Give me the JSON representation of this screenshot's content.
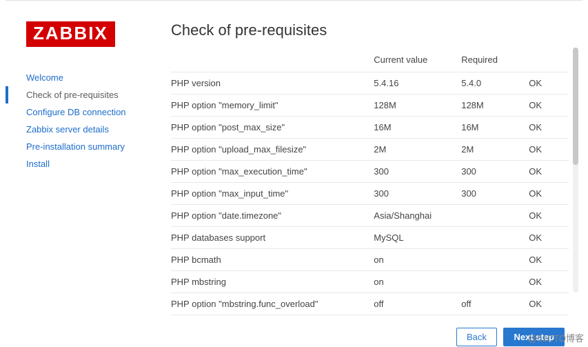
{
  "logo_text": "ZABBIX",
  "title": "Check of pre-requisites",
  "nav": {
    "items": [
      {
        "label": "Welcome",
        "active": false
      },
      {
        "label": "Check of pre-requisites",
        "active": true
      },
      {
        "label": "Configure DB connection",
        "active": false
      },
      {
        "label": "Zabbix server details",
        "active": false
      },
      {
        "label": "Pre-installation summary",
        "active": false
      },
      {
        "label": "Install",
        "active": false
      }
    ]
  },
  "table": {
    "headers": {
      "current": "Current value",
      "required": "Required"
    },
    "rows": [
      {
        "name": "PHP version",
        "current": "5.4.16",
        "required": "5.4.0",
        "status": "OK"
      },
      {
        "name": "PHP option \"memory_limit\"",
        "current": "128M",
        "required": "128M",
        "status": "OK"
      },
      {
        "name": "PHP option \"post_max_size\"",
        "current": "16M",
        "required": "16M",
        "status": "OK"
      },
      {
        "name": "PHP option \"upload_max_filesize\"",
        "current": "2M",
        "required": "2M",
        "status": "OK"
      },
      {
        "name": "PHP option \"max_execution_time\"",
        "current": "300",
        "required": "300",
        "status": "OK"
      },
      {
        "name": "PHP option \"max_input_time\"",
        "current": "300",
        "required": "300",
        "status": "OK"
      },
      {
        "name": "PHP option \"date.timezone\"",
        "current": "Asia/Shanghai",
        "required": "",
        "status": "OK"
      },
      {
        "name": "PHP databases support",
        "current": "MySQL",
        "required": "",
        "status": "OK"
      },
      {
        "name": "PHP bcmath",
        "current": "on",
        "required": "",
        "status": "OK"
      },
      {
        "name": "PHP mbstring",
        "current": "on",
        "required": "",
        "status": "OK"
      },
      {
        "name": "PHP option \"mbstring.func_overload\"",
        "current": "off",
        "required": "off",
        "status": "OK"
      }
    ]
  },
  "buttons": {
    "back": "Back",
    "next": "Next step"
  },
  "watermark": "@51CTO博客"
}
